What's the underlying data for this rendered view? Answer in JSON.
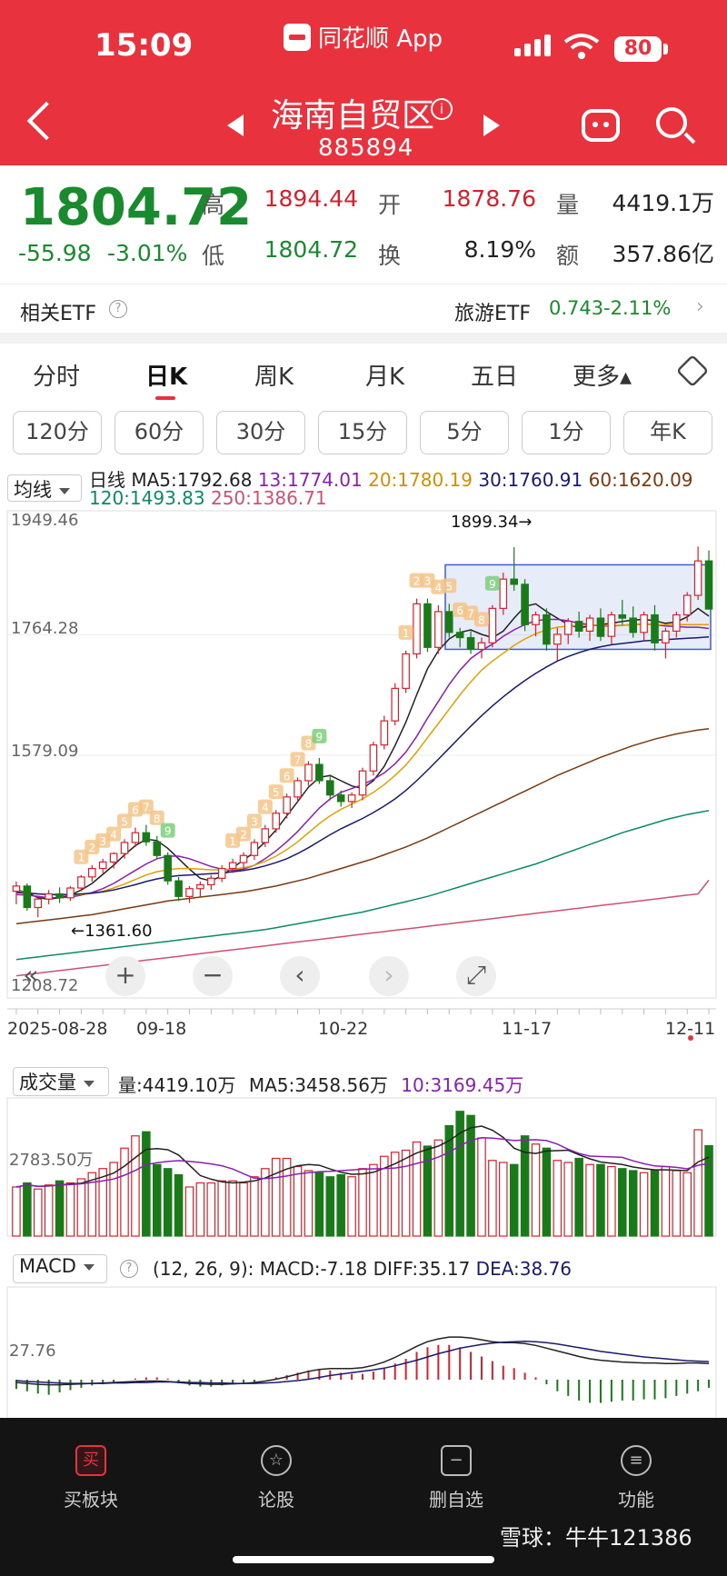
{
  "status": {
    "time": "15:09",
    "battery": "80"
  },
  "app": {
    "name": "同花顺 App"
  },
  "header": {
    "title": "海南自贸区",
    "code": "885894"
  },
  "quote": {
    "price": "1804.72",
    "change": "-55.98",
    "change_pct": "-3.01%",
    "high_label": "高",
    "high": "1894.44",
    "low_label": "低",
    "low": "1804.72",
    "open_label": "开",
    "open": "1878.76",
    "turnover_label": "换",
    "turnover": "8.19%",
    "volume_label": "量",
    "volume": "4419.1万",
    "amount_label": "额",
    "amount": "357.86亿"
  },
  "etf": {
    "label": "相关ETF",
    "name": "旅游ETF",
    "price": "0.743",
    "pct": "-2.11%"
  },
  "tabs": [
    "分时",
    "日K",
    "周K",
    "月K",
    "五日",
    "更多▴"
  ],
  "periods": [
    "120分",
    "60分",
    "30分",
    "15分",
    "5分",
    "1分",
    "年K"
  ],
  "ma_bar": {
    "selector": "均线",
    "kind": "日线",
    "ma5": "MA5:1792.68",
    "ma13": "13:1774.01",
    "ma20": "20:1780.19",
    "ma30": "30:1760.91",
    "ma60": "60:1620.09",
    "ma120": "120:1493.83",
    "ma250": "250:1386.71"
  },
  "colors": {
    "up": "#d8202a",
    "down": "#1a7a1a",
    "ma5": "#222222",
    "ma13": "#8a1fb0",
    "ma20": "#e0a000",
    "ma30": "#1a1a6e",
    "ma60": "#7a3a10",
    "ma120": "#0a8a6a",
    "ma250": "#d05070"
  },
  "price_axis": [
    "1949.46",
    "1764.28",
    "1579.09",
    "1208.72"
  ],
  "annotations": {
    "high": "1899.34→",
    "low": "←1361.60"
  },
  "date_axis": [
    "2025-08-28",
    "09-18",
    "10-22",
    "11-17",
    "12-11"
  ],
  "volume_bar": {
    "selector": "成交量",
    "vol": "量:4419.10万",
    "ma5": "MA5:3458.56万",
    "ma10": "10:3169.45万",
    "axis": "2783.50万"
  },
  "macd_bar": {
    "selector": "MACD",
    "params": "(12, 26, 9):",
    "macd": "MACD:-7.18",
    "diff": "DIFF:35.17",
    "dea": "DEA:38.76",
    "axis": "27.76"
  },
  "seq_labels": [
    "1",
    "2",
    "3",
    "4",
    "5",
    "6",
    "7",
    "8",
    "9",
    "1",
    "2",
    "3",
    "4",
    "5",
    "6",
    "7",
    "8",
    "9",
    "1",
    "2",
    "3",
    "4",
    "5",
    "6",
    "7",
    "8",
    "9"
  ],
  "chart_data": {
    "type": "candlestick",
    "ylim": [
      1208.72,
      1949.46
    ],
    "candles": [
      [
        1370,
        1385,
        1350,
        1378
      ],
      [
        1378,
        1382,
        1340,
        1345
      ],
      [
        1345,
        1360,
        1330,
        1358
      ],
      [
        1358,
        1372,
        1350,
        1366
      ],
      [
        1366,
        1376,
        1352,
        1360
      ],
      [
        1360,
        1378,
        1355,
        1375
      ],
      [
        1375,
        1395,
        1370,
        1392
      ],
      [
        1392,
        1410,
        1385,
        1405
      ],
      [
        1405,
        1420,
        1398,
        1415
      ],
      [
        1415,
        1430,
        1405,
        1428
      ],
      [
        1428,
        1450,
        1420,
        1445
      ],
      [
        1445,
        1468,
        1438,
        1460
      ],
      [
        1460,
        1472,
        1440,
        1446
      ],
      [
        1446,
        1455,
        1420,
        1425
      ],
      [
        1425,
        1430,
        1380,
        1386
      ],
      [
        1386,
        1392,
        1355,
        1362
      ],
      [
        1362,
        1378,
        1352,
        1374
      ],
      [
        1374,
        1385,
        1362,
        1380
      ],
      [
        1380,
        1395,
        1372,
        1390
      ],
      [
        1390,
        1410,
        1384,
        1405
      ],
      [
        1405,
        1420,
        1398,
        1414
      ],
      [
        1414,
        1430,
        1405,
        1425
      ],
      [
        1425,
        1450,
        1418,
        1445
      ],
      [
        1445,
        1472,
        1438,
        1466
      ],
      [
        1466,
        1495,
        1460,
        1490
      ],
      [
        1490,
        1520,
        1482,
        1515
      ],
      [
        1515,
        1545,
        1508,
        1540
      ],
      [
        1540,
        1570,
        1532,
        1565
      ],
      [
        1565,
        1575,
        1535,
        1540
      ],
      [
        1540,
        1548,
        1510,
        1518
      ],
      [
        1518,
        1525,
        1500,
        1508
      ],
      [
        1508,
        1522,
        1498,
        1518
      ],
      [
        1518,
        1560,
        1510,
        1555
      ],
      [
        1555,
        1600,
        1548,
        1595
      ],
      [
        1595,
        1640,
        1588,
        1632
      ],
      [
        1632,
        1690,
        1625,
        1682
      ],
      [
        1682,
        1740,
        1675,
        1735
      ],
      [
        1735,
        1820,
        1728,
        1812
      ],
      [
        1812,
        1820,
        1738,
        1745
      ],
      [
        1745,
        1810,
        1735,
        1800
      ],
      [
        1800,
        1812,
        1760,
        1768
      ],
      [
        1768,
        1775,
        1745,
        1760
      ],
      [
        1760,
        1770,
        1735,
        1742
      ],
      [
        1742,
        1760,
        1728,
        1752
      ],
      [
        1752,
        1810,
        1745,
        1805
      ],
      [
        1805,
        1860,
        1795,
        1850
      ],
      [
        1850,
        1899,
        1832,
        1842
      ],
      [
        1842,
        1850,
        1770,
        1780
      ],
      [
        1780,
        1800,
        1762,
        1795
      ],
      [
        1795,
        1805,
        1740,
        1750
      ],
      [
        1750,
        1775,
        1725,
        1765
      ],
      [
        1765,
        1790,
        1750,
        1785
      ],
      [
        1785,
        1800,
        1760,
        1770
      ],
      [
        1770,
        1795,
        1755,
        1790
      ],
      [
        1790,
        1805,
        1755,
        1762
      ],
      [
        1762,
        1800,
        1750,
        1795
      ],
      [
        1795,
        1818,
        1780,
        1790
      ],
      [
        1790,
        1808,
        1760,
        1768
      ],
      [
        1768,
        1800,
        1755,
        1795
      ],
      [
        1795,
        1810,
        1740,
        1752
      ],
      [
        1752,
        1775,
        1728,
        1770
      ],
      [
        1770,
        1800,
        1760,
        1795
      ],
      [
        1795,
        1830,
        1785,
        1825
      ],
      [
        1825,
        1900,
        1818,
        1878
      ],
      [
        1878,
        1894,
        1804,
        1804
      ]
    ],
    "ma_lines": {
      "ma5": [
        1372,
        1368,
        1360,
        1358,
        1360,
        1364,
        1372,
        1382,
        1396,
        1410,
        1426,
        1440,
        1450,
        1448,
        1436,
        1420,
        1404,
        1390,
        1386,
        1394,
        1406,
        1418,
        1430,
        1446,
        1464,
        1486,
        1508,
        1530,
        1545,
        1548,
        1540,
        1532,
        1528,
        1540,
        1562,
        1594,
        1630,
        1672,
        1712,
        1740,
        1758,
        1768,
        1772,
        1765,
        1760,
        1770,
        1790,
        1808,
        1812,
        1800,
        1790,
        1780,
        1775,
        1778,
        1780,
        1782,
        1785,
        1787,
        1788,
        1786,
        1782,
        1784,
        1792,
        1805,
        1793
      ],
      "ma13": [
        1365,
        1364,
        1362,
        1360,
        1360,
        1361,
        1364,
        1368,
        1374,
        1382,
        1392,
        1402,
        1412,
        1420,
        1424,
        1424,
        1420,
        1414,
        1408,
        1404,
        1402,
        1404,
        1410,
        1420,
        1432,
        1446,
        1462,
        1480,
        1498,
        1512,
        1522,
        1528,
        1534,
        1542,
        1552,
        1566,
        1584,
        1608,
        1636,
        1662,
        1688,
        1710,
        1728,
        1740,
        1750,
        1762,
        1772,
        1780,
        1786,
        1788,
        1788,
        1786,
        1782,
        1780,
        1778,
        1778,
        1779,
        1780,
        1781,
        1780,
        1778,
        1777,
        1776,
        1776,
        1774
      ],
      "ma20": [
        1370,
        1368,
        1366,
        1365,
        1364,
        1364,
        1365,
        1367,
        1370,
        1375,
        1381,
        1388,
        1395,
        1400,
        1403,
        1405,
        1405,
        1404,
        1403,
        1403,
        1404,
        1406,
        1410,
        1416,
        1424,
        1434,
        1446,
        1460,
        1474,
        1486,
        1496,
        1504,
        1512,
        1522,
        1534,
        1548,
        1564,
        1584,
        1606,
        1628,
        1650,
        1672,
        1692,
        1710,
        1724,
        1736,
        1748,
        1758,
        1766,
        1772,
        1776,
        1778,
        1779,
        1779,
        1779,
        1779,
        1779,
        1780,
        1780,
        1780,
        1780,
        1780,
        1780,
        1780,
        1780
      ],
      "ma30": [
        1368,
        1367,
        1366,
        1365,
        1365,
        1365,
        1366,
        1367,
        1369,
        1372,
        1376,
        1380,
        1385,
        1389,
        1392,
        1394,
        1395,
        1396,
        1397,
        1398,
        1400,
        1402,
        1405,
        1409,
        1414,
        1420,
        1428,
        1437,
        1447,
        1457,
        1466,
        1474,
        1482,
        1491,
        1501,
        1512,
        1525,
        1540,
        1556,
        1573,
        1590,
        1607,
        1624,
        1640,
        1655,
        1669,
        1682,
        1694,
        1705,
        1715,
        1724,
        1731,
        1737,
        1742,
        1746,
        1749,
        1751,
        1753,
        1755,
        1756,
        1757,
        1758,
        1759,
        1760,
        1761
      ],
      "ma60": [
        1320,
        1322,
        1324,
        1326,
        1328,
        1330,
        1332,
        1334,
        1337,
        1340,
        1343,
        1346,
        1349,
        1352,
        1355,
        1357,
        1359,
        1361,
        1363,
        1365,
        1367,
        1369,
        1372,
        1375,
        1378,
        1382,
        1386,
        1390,
        1395,
        1400,
        1405,
        1410,
        1415,
        1420,
        1426,
        1432,
        1438,
        1445,
        1452,
        1460,
        1468,
        1476,
        1484,
        1492,
        1500,
        1508,
        1516,
        1524,
        1532,
        1540,
        1548,
        1555,
        1562,
        1569,
        1576,
        1582,
        1588,
        1594,
        1599,
        1604,
        1608,
        1612,
        1615,
        1618,
        1620
      ],
      "ma120": [
        1265,
        1267,
        1269,
        1271,
        1273,
        1275,
        1277,
        1279,
        1281,
        1283,
        1285,
        1287,
        1289,
        1291,
        1293,
        1295,
        1297,
        1299,
        1301,
        1303,
        1305,
        1307,
        1309,
        1311,
        1314,
        1317,
        1320,
        1323,
        1326,
        1329,
        1332,
        1335,
        1338,
        1342,
        1346,
        1350,
        1354,
        1358,
        1362,
        1367,
        1372,
        1377,
        1382,
        1387,
        1392,
        1397,
        1402,
        1407,
        1412,
        1418,
        1424,
        1430,
        1436,
        1442,
        1448,
        1454,
        1460,
        1465,
        1470,
        1475,
        1480,
        1484,
        1488,
        1491,
        1494
      ],
      "ma250": [
        1240,
        1242,
        1244,
        1246,
        1248,
        1250,
        1252,
        1254,
        1256,
        1258,
        1260,
        1262,
        1264,
        1266,
        1268,
        1270,
        1272,
        1274,
        1276,
        1278,
        1280,
        1282,
        1284,
        1286,
        1288,
        1290,
        1292,
        1294,
        1296,
        1298,
        1300,
        1302,
        1304,
        1306,
        1308,
        1310,
        1312,
        1314,
        1316,
        1318,
        1320,
        1322,
        1324,
        1326,
        1328,
        1330,
        1332,
        1334,
        1336,
        1338,
        1340,
        1342,
        1344,
        1346,
        1348,
        1350,
        1352,
        1354,
        1356,
        1358,
        1360,
        1362,
        1364,
        1366,
        1387
      ]
    },
    "volume": [
      2400,
      2600,
      2300,
      2500,
      2700,
      2600,
      2800,
      3100,
      3300,
      3600,
      4300,
      4900,
      5100,
      3500,
      3300,
      3000,
      2400,
      2600,
      2600,
      2700,
      2700,
      2600,
      2900,
      3300,
      3800,
      3800,
      3400,
      3200,
      3100,
      2900,
      3000,
      2900,
      3300,
      3500,
      3900,
      4100,
      4200,
      4600,
      4400,
      4700,
      5400,
      6100,
      5900,
      4800,
      3700,
      3600,
      3500,
      4900,
      4500,
      4300,
      3700,
      3600,
      3800,
      3500,
      3500,
      3400,
      3300,
      3200,
      3100,
      3200,
      3400,
      3200,
      3100,
      5200,
      4419
    ],
    "macd_hist": [
      -8,
      -10,
      -12,
      -13,
      -11,
      -9,
      -7,
      -5,
      -4,
      -2,
      0,
      1,
      2,
      2,
      1,
      -3,
      -5,
      -6,
      -6,
      -5,
      -4,
      -3,
      -2,
      0,
      2,
      4,
      6,
      8,
      9,
      8,
      6,
      5,
      5,
      7,
      10,
      14,
      18,
      24,
      28,
      30,
      30,
      28,
      24,
      20,
      16,
      12,
      10,
      6,
      2,
      -4,
      -10,
      -14,
      -18,
      -20,
      -20,
      -19,
      -18,
      -18,
      -17,
      -17,
      -16,
      -14,
      -12,
      -10,
      -7
    ],
    "macd_diff": [
      -6,
      -8,
      -10,
      -11,
      -11,
      -10,
      -9,
      -8,
      -7,
      -6,
      -5,
      -4,
      -3,
      -3,
      -4,
      -6,
      -8,
      -9,
      -10,
      -10,
      -9,
      -8,
      -6,
      -3,
      1,
      6,
      12,
      18,
      22,
      24,
      24,
      24,
      26,
      31,
      38,
      48,
      60,
      72,
      82,
      88,
      92,
      92,
      90,
      86,
      82,
      80,
      80,
      78,
      74,
      68,
      62,
      56,
      50,
      45,
      42,
      40,
      38,
      37,
      36,
      36,
      35,
      35,
      36,
      36,
      35
    ],
    "macd_dea": [
      -2,
      -4,
      -5,
      -6,
      -7,
      -8,
      -8,
      -8,
      -8,
      -7,
      -7,
      -6,
      -6,
      -5,
      -5,
      -5,
      -6,
      -6,
      -7,
      -7,
      -8,
      -8,
      -8,
      -7,
      -6,
      -4,
      -2,
      1,
      5,
      9,
      12,
      15,
      18,
      21,
      25,
      30,
      36,
      42,
      49,
      56,
      62,
      68,
      72,
      76,
      79,
      81,
      82,
      83,
      82,
      80,
      77,
      73,
      69,
      65,
      61,
      58,
      55,
      52,
      49,
      47,
      45,
      43,
      41,
      40,
      39
    ]
  },
  "bottom_nav": [
    "买板块",
    "论股",
    "删自选",
    "功能"
  ],
  "watermark": "雪球：牛牛121386"
}
